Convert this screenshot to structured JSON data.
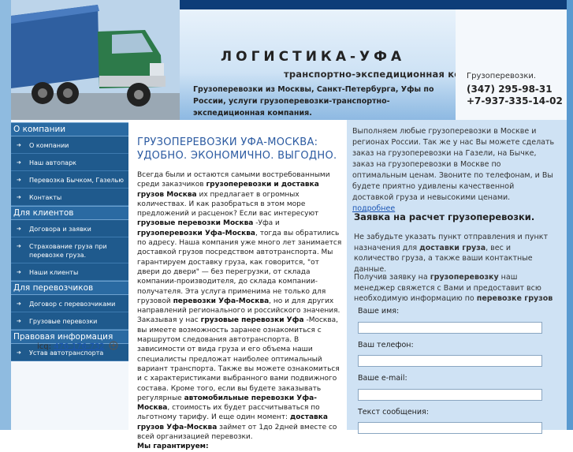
{
  "header": {
    "title": "ЛОГИСТИКА-УФА",
    "subtitle": "транспортно-экспедиционная компания",
    "description": "Грузоперевозки из Москвы, Санкт-Петербурга, Уфы по России, услуги грузоперевозки-транспортно-экспедиционная компания.",
    "contact_label": "Грузоперевозки.",
    "phone1": "(347) 295-98-31",
    "phone2": "+7-937-335-14-02"
  },
  "sidebar": {
    "sections": [
      {
        "title": "О компании",
        "items": [
          "О компании",
          "Наш автопарк",
          "Перевозка Бычком, Газелью",
          "Контакты"
        ]
      },
      {
        "title": "Для клиентов",
        "items": [
          "Договора и заявки",
          "Страхование груза при перевозке груза.",
          "Наши клиенты"
        ]
      },
      {
        "title": "Для перевозчиков",
        "items": [
          "Договор с перевозчиками",
          "Грузовые перевозки"
        ]
      },
      {
        "title": "Правовая информация",
        "items": [
          "Устав автотранспорта"
        ]
      }
    ],
    "icq_label": "icq:",
    "icq_number": "476-176-732"
  },
  "main": {
    "title": "ГРУЗОПЕРЕВОЗКИ УФА-МОСКВА: УДОБНО. ЭКОНОМИЧНО. ВЫГОДНО.",
    "p1_a": "Всегда были и остаются самыми востребованными среди заказчиков ",
    "p1_b": "грузоперевозки и доставка грузов Москва",
    "p1_c": " их предлагает в огромных количествах. И как разобраться в этом море предложений и расценок? Если вас интересуют ",
    "p1_d": "грузовые перевозки Москва",
    "p1_e": " -Уфа и ",
    "p1_f": "грузоперевозки Уфа-Москва",
    "p1_g": ", тогда вы обратились по адресу. Наша компания уже много лет занимается доставкой грузов посредством автотранспорта. Мы гарантируем доставку груза, как говорится, \"от двери до двери\" — без перегрузки, от склада компании-производителя, до склада компании-получателя. Эта услуга применима не только для грузовой ",
    "p1_h": "перевозки Уфа-Москва",
    "p1_i": ", но и для других направлений регионального и российского значения.",
    "p2_a": "Заказывая у нас ",
    "p2_b": "грузовые перевозки Уфа",
    "p2_c": " -Москва, вы имеете возможность заранее ознакомиться с маршрутом следования автотранспорта. В зависимости от вида груза и его объема наши специалисты предложат наиболее оптимальный вариант транспорта. Также вы можете ознакомиться и с характеристиками выбранного вами подвижного состава. Кроме того, если вы будете заказывать регулярные ",
    "p2_d": "автомобильные перевозки Уфа-Москва",
    "p2_e": ", стоимость их будет рассчитываться по льготному тарифу. И еще один момент: ",
    "p2_f": "доставка грузов",
    "p2_g": " Уфа-Москва",
    "p2_h": " займет от 1до 2дней вместе со всей организацией перевозки.",
    "p3": "Мы гарантируем:"
  },
  "right": {
    "intro": "Выполняем любые грузоперевозки в Москве и регионах России. Так же у нас Вы можете сделать заказ на грузоперевозки на Газели, на Бычке, заказ на грузоперевозки в Москве по оптимальным ценам. Звоните по телефонам, и Вы будете приятно удивлены качественной доставкой груза и невысокими ценами.",
    "more_link": "подробнее",
    "request_title": "Заявка на расчет грузоперевозки.",
    "request_text_a": "Не забудьте указать пункт отправления и пункт назначения для ",
    "request_text_b": "доставки груза",
    "request_text_c": ", вес и количество груза, а также ваши контактные данные.",
    "request_text2_a": "Получив заявку на ",
    "request_text2_b": "грузоперевозку",
    "request_text2_c": " наш менеджер свяжется с Вами и предоставит всю необходимую информацию по ",
    "request_text2_d": "перевозке грузов",
    "form": {
      "name_label": "Ваше имя:",
      "phone_label": "Ваш телефон:",
      "email_label": "Ваше e-mail:",
      "message_label": "Текст сообщения:"
    }
  },
  "colors": {
    "menu_bg": "#1f5a8d",
    "menu_head": "#2a6aa2",
    "title_blue": "#2b5aa1",
    "panel_bg": "#cfe2f4",
    "topbar": "#0d3d78"
  }
}
